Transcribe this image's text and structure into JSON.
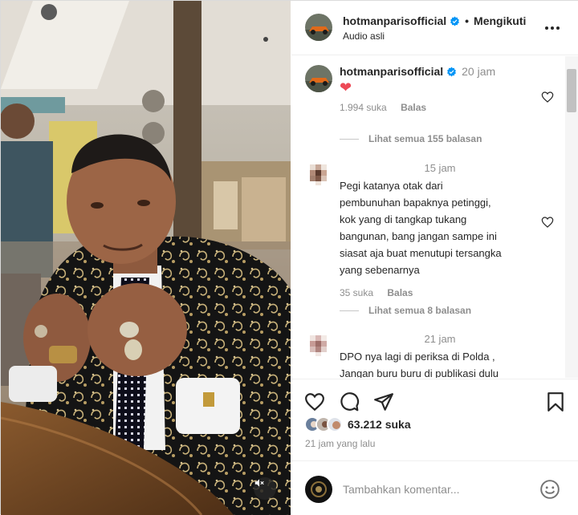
{
  "header": {
    "username": "hotmanparisofficial",
    "separator": "•",
    "follow_status": "Mengikuti",
    "audio": "Audio asli"
  },
  "comments": [
    {
      "username": "hotmanparisofficial",
      "time": "20 jam",
      "text": "❤",
      "likes": "1.994 suka",
      "reply": "Balas",
      "see_replies": "Lihat semua 155 balasan"
    },
    {
      "username": "",
      "time": "15 jam",
      "text": "Pegi katanya otak dari\npembunuhan bapaknya petinggi,\nkok yang di tangkap tukang\nbangunan, bang jangan sampe ini\nsiasat aja buat menutupi tersangka\nyang sebenarnya",
      "likes": "35 suka",
      "reply": "Balas",
      "see_replies": "Lihat semua 8 balasan"
    },
    {
      "username": "",
      "time": "21 jam",
      "text": "DPO nya lagi di periksa di Polda ,\nJangan buru buru di publikasi dulu"
    }
  ],
  "actions": {
    "icons": [
      "heart-icon",
      "comment-icon",
      "share-icon",
      "bookmark-icon"
    ]
  },
  "likes": {
    "count": "63.212 suka"
  },
  "posted": "21 jam yang lalu",
  "add_comment": {
    "placeholder": "Tambahkan komentar..."
  },
  "colors": {
    "verified": "#0095f6",
    "heart": "#ed4956",
    "muted_text": "#8e8e8e"
  }
}
